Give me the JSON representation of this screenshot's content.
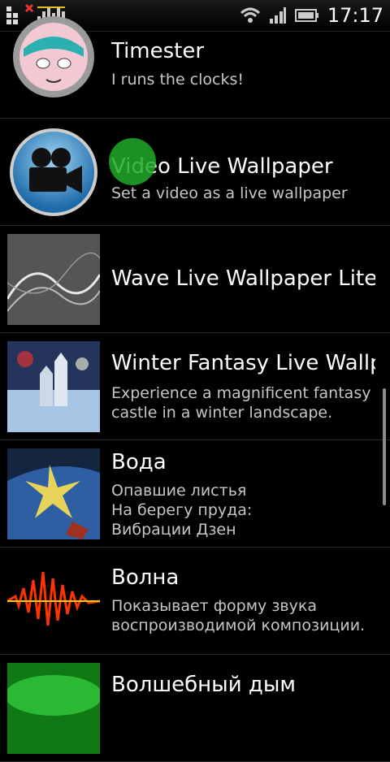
{
  "status_bar": {
    "time": "17:17",
    "icons": [
      "notification-icon",
      "equalizer-icon",
      "wifi-icon",
      "signal-icon",
      "battery-icon"
    ]
  },
  "wallpapers": [
    {
      "title": "Timester",
      "description": [
        "I runs the clocks!"
      ]
    },
    {
      "title": "Video Live Wallpaper",
      "description": [
        "Set a video as a live wallpaper"
      ]
    },
    {
      "title": "Wave Live Wallpaper Lite",
      "description": []
    },
    {
      "title": "Winter Fantasy Live Wallpa",
      "description": [
        "Experience a magnificent fantasy",
        "castle in a winter landscape."
      ]
    },
    {
      "title": "Вода",
      "description": [
        "Опавшие листья",
        "На берегу пруда:",
        "Вибрации Дзен"
      ]
    },
    {
      "title": "Волна",
      "description": [
        "Показывает форму звука",
        "воспроизводимой композиции."
      ]
    },
    {
      "title": "Волшебный дым",
      "description": []
    }
  ]
}
